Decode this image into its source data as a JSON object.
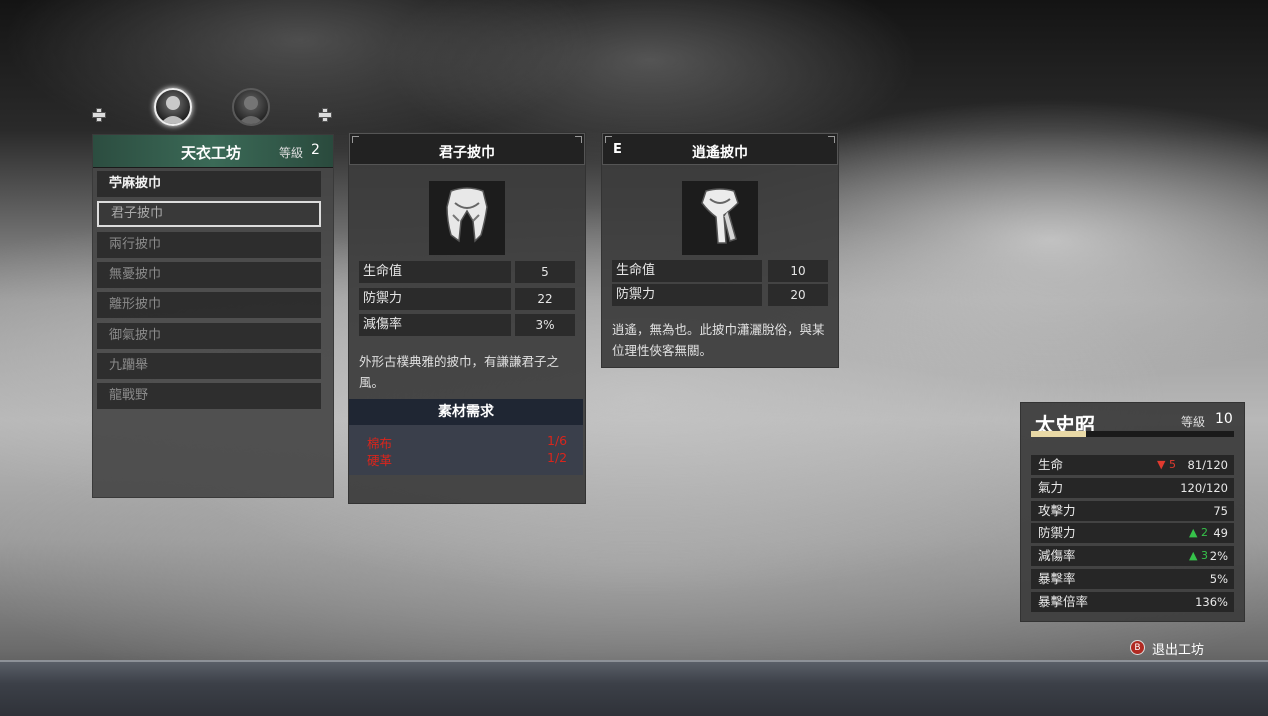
{
  "list": {
    "title": "天衣工坊",
    "level_label": "等級",
    "level": "2",
    "items": [
      {
        "label": "苧麻披巾",
        "state": "unlocked"
      },
      {
        "label": "君子披巾",
        "state": "selected"
      },
      {
        "label": "兩行披巾",
        "state": "locked"
      },
      {
        "label": "無憂披巾",
        "state": "locked"
      },
      {
        "label": "離形披巾",
        "state": "locked"
      },
      {
        "label": "御氣披巾",
        "state": "locked"
      },
      {
        "label": "九躪舉",
        "state": "locked"
      },
      {
        "label": "龍戰野",
        "state": "locked"
      }
    ]
  },
  "selected_item": {
    "name": "君子披巾",
    "icon": "scarf-icon",
    "stats": [
      {
        "label": "生命值",
        "value": "5"
      },
      {
        "label": "防禦力",
        "value": "22"
      },
      {
        "label": "減傷率",
        "value": "3%"
      }
    ],
    "description": "外形古樸典雅的披巾，有謙謙君子之風。",
    "materials_title": "素材需求",
    "materials": [
      {
        "name": "棉布",
        "count": "1/6"
      },
      {
        "name": "硬革",
        "count": "1/2"
      }
    ]
  },
  "equipped_item": {
    "tag": "E",
    "name": "逍遙披巾",
    "icon": "scarf-icon",
    "stats": [
      {
        "label": "生命值",
        "value": "10"
      },
      {
        "label": "防禦力",
        "value": "20"
      }
    ],
    "description": "逍遙，無為也。此披巾瀟灑脫俗，與某位理性俠客無關。"
  },
  "character": {
    "name": "太史昭",
    "level_label": "等級",
    "level": "10",
    "xp_fraction": 0.27,
    "stats": [
      {
        "label": "生命",
        "delta": "▼ 5",
        "delta_dir": "down",
        "value": "81/120"
      },
      {
        "label": "氣力",
        "delta": "",
        "delta_dir": "",
        "value": "120/120"
      },
      {
        "label": "攻擊力",
        "delta": "",
        "delta_dir": "",
        "value": "75"
      },
      {
        "label": "防禦力",
        "delta": "▲ 2",
        "delta_dir": "up",
        "value": "49"
      },
      {
        "label": "減傷率",
        "delta": "▲ 3",
        "delta_dir": "up",
        "value": "2%"
      },
      {
        "label": "暴擊率",
        "delta": "",
        "delta_dir": "",
        "value": "5%"
      },
      {
        "label": "暴擊倍率",
        "delta": "",
        "delta_dir": "",
        "value": "136%"
      }
    ]
  },
  "footer": {
    "button_glyph": "B",
    "exit_label": "退出工坊"
  },
  "colors": {
    "header_green": "#3b6a57",
    "material_red": "#d9251c",
    "delta_up": "#36c24a",
    "delta_down": "#e03a2f"
  }
}
